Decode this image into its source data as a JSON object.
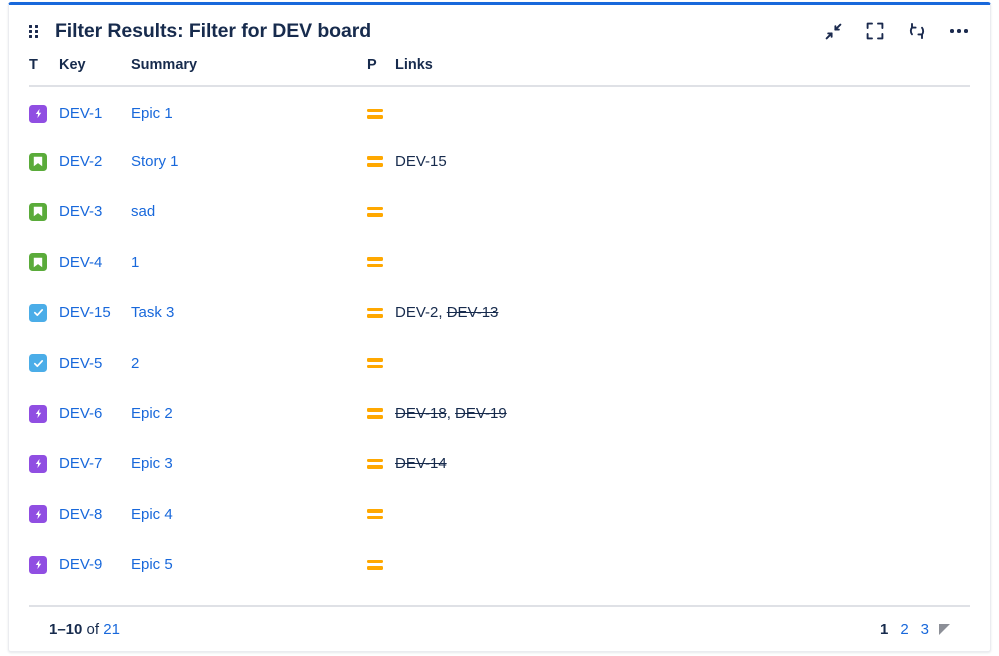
{
  "gadget": {
    "title": "Filter Results: Filter for DEV board",
    "accent_color": "#1868DB",
    "drag_handle_icon": "drag-handle-icon",
    "actions": [
      {
        "name": "collapse-icon",
        "label": "Minimise"
      },
      {
        "name": "expand-icon",
        "label": "Maximise"
      },
      {
        "name": "refresh-icon",
        "label": "Refresh"
      },
      {
        "name": "more-options-icon",
        "label": "More actions"
      }
    ]
  },
  "table": {
    "columns": [
      {
        "key": "type",
        "label": "T"
      },
      {
        "key": "key",
        "label": "Key"
      },
      {
        "key": "summary",
        "label": "Summary"
      },
      {
        "key": "priority",
        "label": "P"
      },
      {
        "key": "links",
        "label": "Links"
      }
    ],
    "rows": [
      {
        "type": "epic",
        "type_icon": "epic-icon",
        "key": "DEV-1",
        "summary": "Epic 1",
        "priority": "Medium",
        "priority_icon": "priority-medium-icon",
        "links": []
      },
      {
        "type": "story",
        "type_icon": "story-icon",
        "key": "DEV-2",
        "summary": "Story 1",
        "priority": "Medium",
        "priority_icon": "priority-medium-icon",
        "links": [
          {
            "key": "DEV-15",
            "done": false
          }
        ]
      },
      {
        "type": "story",
        "type_icon": "story-icon",
        "key": "DEV-3",
        "summary": "sad",
        "priority": "Medium",
        "priority_icon": "priority-medium-icon",
        "links": []
      },
      {
        "type": "story",
        "type_icon": "story-icon",
        "key": "DEV-4",
        "summary": "1",
        "priority": "Medium",
        "priority_icon": "priority-medium-icon",
        "links": []
      },
      {
        "type": "task",
        "type_icon": "task-icon",
        "key": "DEV-15",
        "summary": "Task 3",
        "priority": "Medium",
        "priority_icon": "priority-medium-icon",
        "links": [
          {
            "key": "DEV-2",
            "done": false
          },
          {
            "key": "DEV-13",
            "done": true
          }
        ]
      },
      {
        "type": "task",
        "type_icon": "task-icon",
        "key": "DEV-5",
        "summary": "2",
        "priority": "Medium",
        "priority_icon": "priority-medium-icon",
        "links": []
      },
      {
        "type": "epic",
        "type_icon": "epic-icon",
        "key": "DEV-6",
        "summary": "Epic 2",
        "priority": "Medium",
        "priority_icon": "priority-medium-icon",
        "links": [
          {
            "key": "DEV-18",
            "done": true
          },
          {
            "key": "DEV-19",
            "done": true
          }
        ]
      },
      {
        "type": "epic",
        "type_icon": "epic-icon",
        "key": "DEV-7",
        "summary": "Epic 3",
        "priority": "Medium",
        "priority_icon": "priority-medium-icon",
        "links": [
          {
            "key": "DEV-14",
            "done": true
          }
        ]
      },
      {
        "type": "epic",
        "type_icon": "epic-icon",
        "key": "DEV-8",
        "summary": "Epic 4",
        "priority": "Medium",
        "priority_icon": "priority-medium-icon",
        "links": []
      },
      {
        "type": "epic",
        "type_icon": "epic-icon",
        "key": "DEV-9",
        "summary": "Epic 5",
        "priority": "Medium",
        "priority_icon": "priority-medium-icon",
        "links": []
      }
    ]
  },
  "footer": {
    "range": "1–10",
    "of_label": "of",
    "total": "21",
    "pages": [
      {
        "label": "1",
        "current": true
      },
      {
        "label": "2",
        "current": false
      },
      {
        "label": "3",
        "current": false
      }
    ],
    "next_icon": "next-page-arrow-icon"
  },
  "colors": {
    "link": "#1868DB",
    "text": "#172B4D",
    "epic": "#904EE2",
    "story": "#5AAB3A",
    "task": "#4BADE8",
    "priority_medium": "#FFA800",
    "divider": "#DFE1E6"
  }
}
